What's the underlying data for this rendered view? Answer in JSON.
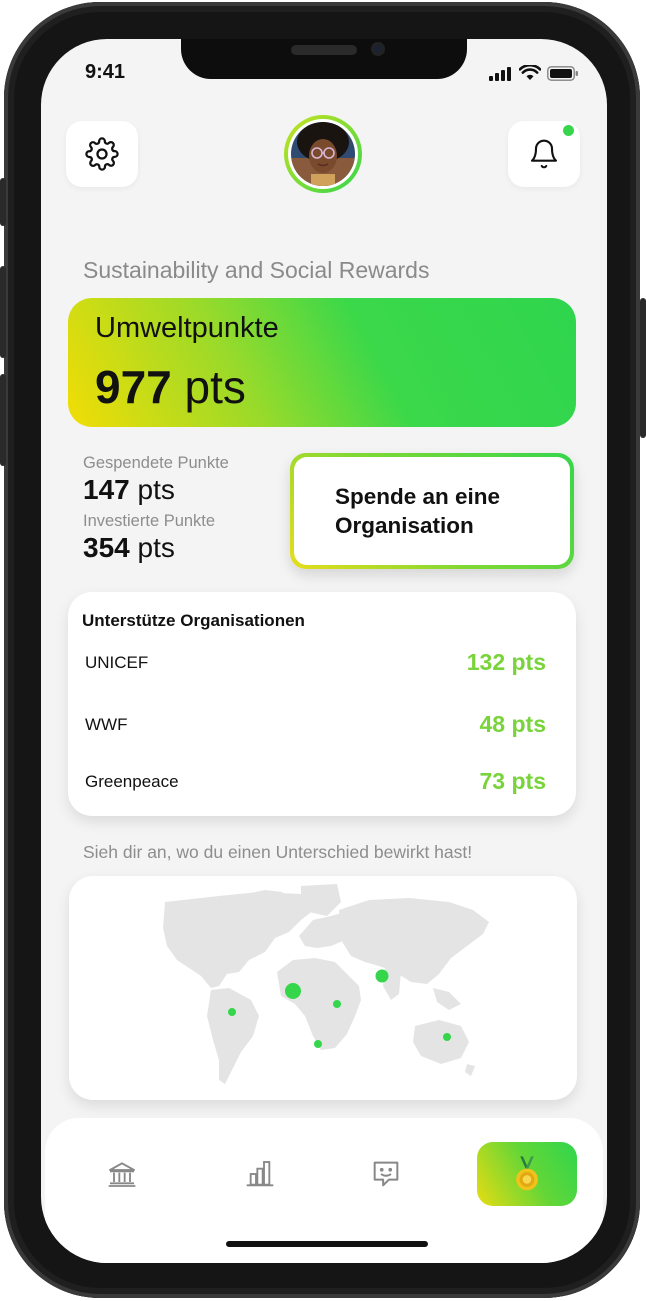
{
  "status": {
    "time": "9:41"
  },
  "header": {
    "settings_icon": "gear-icon",
    "notification_icon": "bell-icon",
    "has_notification": true
  },
  "section_title": "Sustainability and Social Rewards",
  "hero": {
    "label": "Umweltpunkte",
    "value": "977",
    "unit": "pts"
  },
  "stats": {
    "donated": {
      "label": "Gespendete Punkte",
      "value": "147",
      "unit": "pts"
    },
    "invested": {
      "label": "Investierte Punkte",
      "value": "354",
      "unit": "pts"
    }
  },
  "donate_button": {
    "label": "Spende an eine Organisation"
  },
  "organizations": {
    "title": "Unterstütze Organisationen",
    "items": [
      {
        "name": "UNICEF",
        "points": "132 pts"
      },
      {
        "name": "WWF",
        "points": "48 pts"
      },
      {
        "name": "Greenpeace",
        "points": "73 pts"
      }
    ]
  },
  "map": {
    "hint": "Sieh dir an, wo du einen Unterschied bewirkt hast!"
  },
  "nav": {
    "items": [
      {
        "icon": "bank-icon"
      },
      {
        "icon": "bar-chart-icon"
      },
      {
        "icon": "chat-smile-icon"
      },
      {
        "icon": "medal-icon",
        "active": true
      }
    ]
  },
  "colors": {
    "accent_green": "#35d64c",
    "accent_yellow": "#f2dd05",
    "points_green": "#79d33a"
  }
}
